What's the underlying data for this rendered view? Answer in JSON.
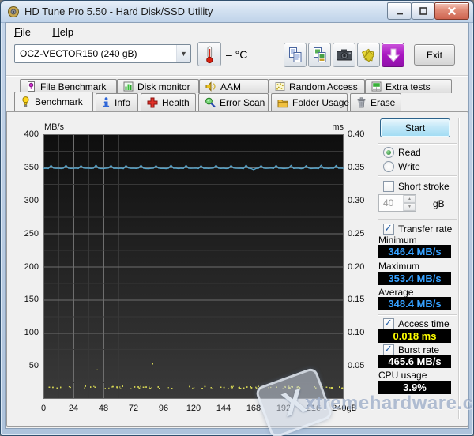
{
  "window": {
    "title": "HD Tune Pro 5.50 - Hard Disk/SSD Utility"
  },
  "menu": {
    "file": "File",
    "help": "Help"
  },
  "toolbar": {
    "drive_select": "OCZ-VECTOR150 (240 gB)",
    "temperature_display": "– °C",
    "icon_buttons": [
      "copy-text",
      "copy-image",
      "screenshot",
      "save-results",
      "update"
    ],
    "exit_label": "Exit"
  },
  "tabs": {
    "row1": [
      {
        "label": "File Benchmark",
        "icon": "file-benchmark-icon"
      },
      {
        "label": "Disk monitor",
        "icon": "disk-monitor-icon"
      },
      {
        "label": "AAM",
        "icon": "aam-icon"
      },
      {
        "label": "Random Access",
        "icon": "random-access-icon"
      },
      {
        "label": "Extra tests",
        "icon": "extra-tests-icon"
      }
    ],
    "row2": [
      {
        "label": "Benchmark",
        "icon": "benchmark-icon",
        "active": true
      },
      {
        "label": "Info",
        "icon": "info-icon"
      },
      {
        "label": "Health",
        "icon": "health-icon"
      },
      {
        "label": "Error Scan",
        "icon": "error-scan-icon"
      },
      {
        "label": "Folder Usage",
        "icon": "folder-usage-icon"
      },
      {
        "label": "Erase",
        "icon": "erase-icon"
      }
    ]
  },
  "controls": {
    "start_label": "Start",
    "read_label": "Read",
    "write_label": "Write",
    "selected_mode": "Read",
    "short_stroke_label": "Short stroke",
    "short_stroke_checked": false,
    "capacity_value": "40",
    "capacity_unit": "gB",
    "transfer_rate_label": "Transfer rate",
    "transfer_rate_checked": true,
    "minimum_label": "Minimum",
    "minimum_value": "346.4 MB/s",
    "maximum_label": "Maximum",
    "maximum_value": "353.4 MB/s",
    "average_label": "Average",
    "average_value": "348.4 MB/s",
    "access_time_label": "Access time",
    "access_time_checked": true,
    "access_time_value": "0.018 ms",
    "burst_rate_label": "Burst rate",
    "burst_rate_checked": true,
    "burst_rate_value": "465.6 MB/s",
    "cpu_usage_label": "CPU usage",
    "cpu_usage_value": "3.9%"
  },
  "chart_data": {
    "type": "line+scatter",
    "left_axis": {
      "label": "MB/s",
      "min": 0,
      "max": 400,
      "ticks": [
        400,
        350,
        300,
        250,
        200,
        150,
        100,
        50
      ]
    },
    "right_axis": {
      "label": "ms",
      "min": 0,
      "max": 0.4,
      "ticks": [
        "0.40",
        "0.35",
        "0.30",
        "0.25",
        "0.20",
        "0.15",
        "0.10",
        "0.05"
      ]
    },
    "x_axis": {
      "min": 0,
      "max": 240,
      "unit": "gB",
      "ticks": [
        0,
        24,
        48,
        72,
        96,
        120,
        144,
        168,
        192,
        216
      ],
      "end_label": "240gB"
    },
    "grid": {
      "minor_x_gb": 12,
      "major_x_gb": 24,
      "minor_y_mbs": 25,
      "major_y_mbs": 50
    },
    "series": [
      {
        "name": "Transfer rate",
        "kind": "line",
        "unit": "MB/s",
        "color": "#54a2c8",
        "x_start": 0,
        "x_step": 2,
        "values": [
          348.3,
          348.6,
          348.2,
          352.9,
          348.8,
          348.4,
          348.5,
          348.2,
          348.7,
          353.1,
          348.5,
          348.3,
          348.4,
          348.8,
          348.3,
          352.6,
          348.9,
          348.5,
          348.6,
          348.3,
          348.5,
          353.4,
          348.7,
          348.2,
          348.2,
          348.5,
          348.9,
          352.8,
          348.4,
          348.6,
          348.3,
          348.7,
          348.1,
          352.7,
          349.0,
          348.4,
          348.5,
          348.3,
          348.8,
          353.0,
          348.6,
          348.2,
          347.9,
          348.4,
          348.6,
          352.5,
          348.8,
          348.3,
          348.4,
          348.1,
          348.7,
          353.2,
          348.5,
          348.6,
          348.2,
          348.6,
          348.3,
          352.9,
          348.7,
          348.4,
          348.5,
          348.8,
          348.2,
          352.6,
          348.4,
          348.7,
          348.3,
          348.5,
          348.9,
          353.1,
          348.6,
          348.3,
          348.6,
          348.2,
          348.4,
          352.8,
          348.9,
          348.5,
          348.4,
          348.7,
          348.1,
          353.3,
          348.5,
          348.2,
          346.4,
          348.3,
          348.6,
          352.7,
          348.8,
          348.4,
          348.5,
          348.9,
          348.3,
          352.9,
          348.6,
          348.7,
          348.2,
          348.4,
          348.8,
          353.0,
          348.3,
          348.5,
          348.7,
          348.1,
          348.5,
          352.6,
          348.9,
          348.2,
          348.4,
          348.6,
          348.2,
          353.2,
          348.7,
          348.5,
          348.3,
          348.8,
          348.4,
          352.8,
          348.5,
          348.6,
          348.4
        ]
      },
      {
        "name": "Access time",
        "kind": "scatter",
        "unit": "ms",
        "color": "#d6d655",
        "value_ms": 0.018,
        "points": 520,
        "seed": 9
      }
    ],
    "summary": {
      "minimum_mbs": 346.4,
      "maximum_mbs": 353.4,
      "average_mbs": 348.4,
      "access_time_ms": 0.018,
      "burst_rate_mbs": 465.6,
      "cpu_usage_pct": 3.9
    }
  },
  "watermark": {
    "text": "xtremehardware.com",
    "logo_letter": "X"
  }
}
